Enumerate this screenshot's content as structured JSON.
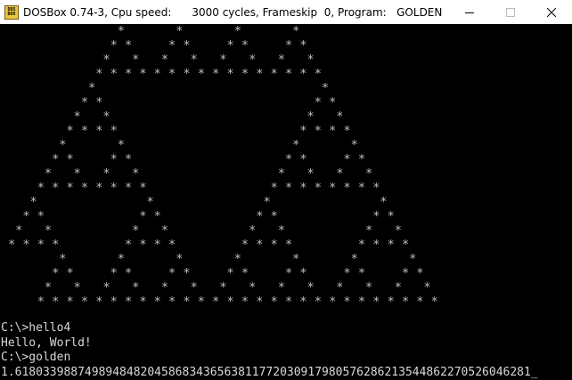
{
  "window": {
    "icon_text": [
      "DOS",
      "BOX"
    ],
    "title": "DOSBox 0.74-3, Cpu speed:      3000 cycles, Frameskip  0, Program:   GOLDEN"
  },
  "screen": {
    "pattern_rows": [
      "               *       *       *       *",
      "              * *     * *     * *     * *",
      "             *   *   *   *   *   *   *   *",
      "            * * * * * * * * * * * * * * * *",
      "           *                               *",
      "          * *                             * *",
      "         *   *                           *   *",
      "        * * * *                         * * * *",
      "       *       *                       *       *",
      "      * *     * *                     * *     * *",
      "     *   *   *   *                   *   *   *   *",
      "    * * * * * * * *                 * * * * * * * *",
      "   *               *               *               *",
      "  * *             * *             * *             * *",
      " *   *           *   *           *   *           *   *",
      "* * * *         * * * *         * * * *         * * * *",
      "       *       *       *       *       *       *       *",
      "      * *     * *     * *     * *     * *     * *     * *",
      "     *   *   *   *   *   *   *   *   *   *   *   *   *   *",
      "    * * * * * * * * * * * * * * * * * * * * * * * * * * * *"
    ],
    "console_lines": [
      "C:\\>hello4",
      "Hello, World!",
      "C:\\>golden",
      "1.6180339887498948482045868343656381177203091798057628621354486227052604628​1_"
    ]
  }
}
